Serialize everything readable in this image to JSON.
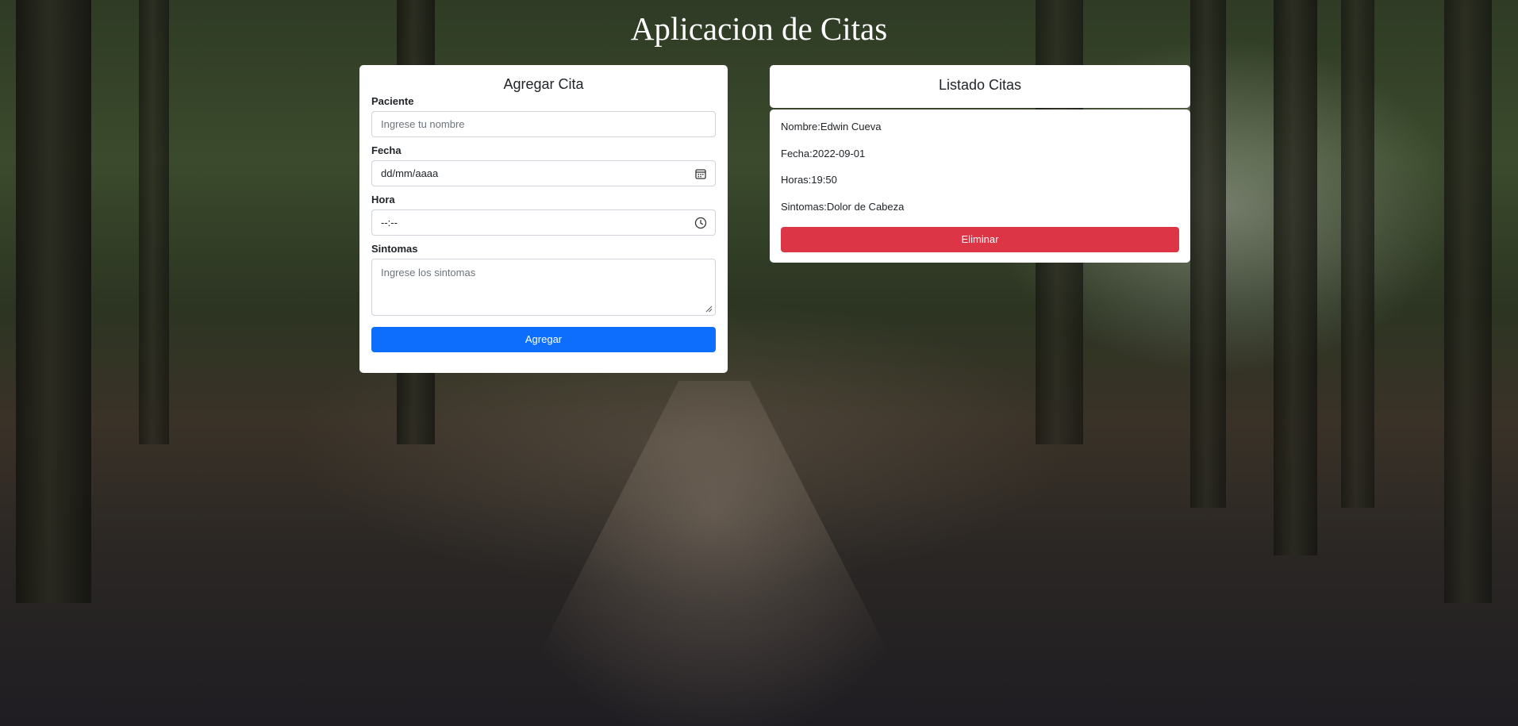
{
  "page": {
    "title": "Aplicacion de Citas"
  },
  "form": {
    "heading": "Agregar Cita",
    "paciente_label": "Paciente",
    "paciente_placeholder": "Ingrese tu nombre",
    "fecha_label": "Fecha",
    "fecha_value": "dd/mm/aaaa",
    "hora_label": "Hora",
    "hora_value": "--:--",
    "sintomas_label": "Sintomas",
    "sintomas_placeholder": "Ingrese los sintomas",
    "submit_label": "Agregar",
    "icons": {
      "fecha": "calendar-icon",
      "hora": "clock-icon"
    }
  },
  "list": {
    "heading": "Listado Citas",
    "appointments": [
      {
        "nombre_label": "Nombre:",
        "nombre": "Edwin Cueva",
        "fecha_label": "Fecha:",
        "fecha": "2022-09-01",
        "hora_label": "Horas:",
        "hora": "19:50",
        "sintomas_label": "Sintomas:",
        "sintomas": "Dolor de Cabeza",
        "delete_label": "Eliminar"
      }
    ]
  },
  "colors": {
    "primary": "#0d6efd",
    "danger": "#dc3545"
  }
}
